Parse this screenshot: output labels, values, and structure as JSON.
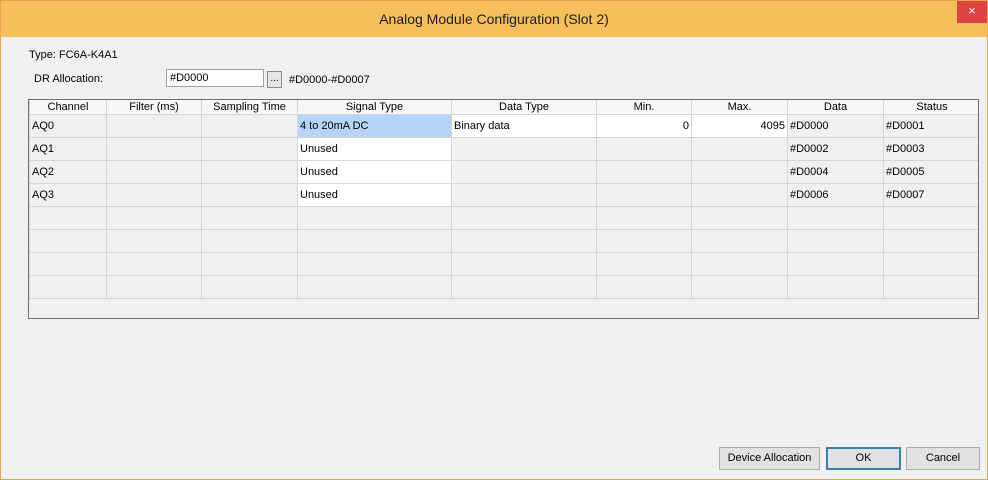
{
  "window": {
    "title": "Analog Module Configuration (Slot 2)",
    "close_glyph": "×"
  },
  "form": {
    "type_label": "Type: FC6A-K4A1",
    "dr_label": "DR Allocation:",
    "dr_value": "#D0000",
    "browse_label": "...",
    "dr_range": "#D0000-#D0007"
  },
  "grid": {
    "columns": [
      "Channel",
      "Filter (ms)",
      "Sampling Time",
      "Signal Type",
      "Data Type",
      "Min.",
      "Max.",
      "Data",
      "Status"
    ],
    "rows": [
      {
        "channel": "AQ0",
        "filter": "",
        "sampling": "",
        "signal_type": "4 to 20mA DC",
        "data_type": "Binary data",
        "min": "0",
        "max": "4095",
        "data": "#D0000",
        "status": "#D0001"
      },
      {
        "channel": "AQ1",
        "filter": "",
        "sampling": "",
        "signal_type": "Unused",
        "data_type": "",
        "min": "",
        "max": "",
        "data": "#D0002",
        "status": "#D0003"
      },
      {
        "channel": "AQ2",
        "filter": "",
        "sampling": "",
        "signal_type": "Unused",
        "data_type": "",
        "min": "",
        "max": "",
        "data": "#D0004",
        "status": "#D0005"
      },
      {
        "channel": "AQ3",
        "filter": "",
        "sampling": "",
        "signal_type": "Unused",
        "data_type": "",
        "min": "",
        "max": "",
        "data": "#D0006",
        "status": "#D0007"
      }
    ]
  },
  "buttons": {
    "device_allocation": "Device Allocation",
    "ok": "OK",
    "cancel": "Cancel"
  },
  "colors": {
    "titlebar": "#f7bf5c",
    "close": "#e04343",
    "selected_cell": "#b5d5f7"
  }
}
